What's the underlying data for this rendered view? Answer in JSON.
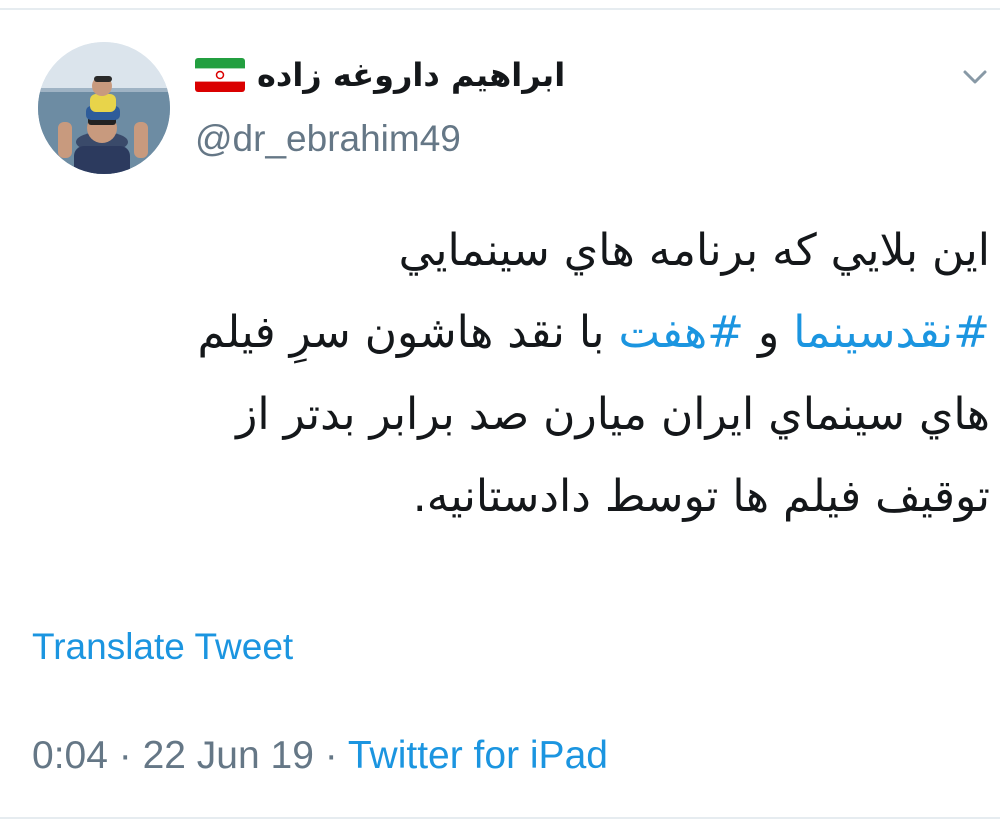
{
  "tweet": {
    "author": {
      "display_name": "ابراهیم داروغه زاده",
      "handle": "@dr_ebrahim49",
      "flag_icon": "iran-flag-icon",
      "avatar_icon": "profile-photo"
    },
    "menu_icon": "chevron-down-icon",
    "body": {
      "line1": "اين بلايي كه برنامه هاي سينمايي",
      "line2_hashtag1": "#نقدسینما",
      "line2_conj": " و ",
      "line2_hashtag2": "#هفت",
      "line2_rest": " با نقد هاشون سرِ فیلم",
      "line3": "هاي سينماي ايران ميارن صد برابر بدتر از",
      "line4": "توقیف فیلم ها توسط دادستانیه."
    },
    "translate_label": "Translate Tweet",
    "meta": {
      "time": "0:04",
      "separator": " · ",
      "date": "22 Jun 19",
      "source": "Twitter for iPad"
    }
  },
  "colors": {
    "link": "#1b95e0",
    "muted": "#657786",
    "text": "#14171a",
    "divider": "#e6ecf0",
    "flag_green": "#239f40",
    "flag_white": "#ffffff",
    "flag_red": "#da0000"
  }
}
